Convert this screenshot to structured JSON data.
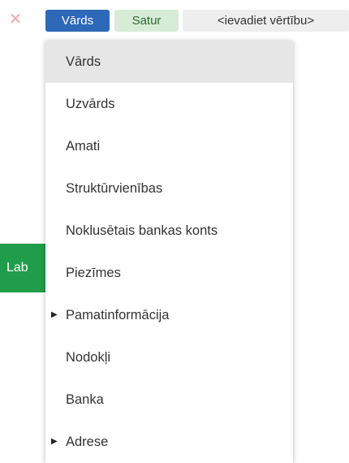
{
  "filter": {
    "remove_symbol": "✕",
    "field_chip": "Vārds",
    "operator_chip": "Satur",
    "value_chip": "<ievadiet vērtību>"
  },
  "side_button": {
    "label": "Lab"
  },
  "dropdown": {
    "items": [
      {
        "label": "Vārds",
        "selected": true
      },
      {
        "label": "Uzvārds"
      },
      {
        "label": "Amati"
      },
      {
        "label": "Struktūrvienības"
      },
      {
        "label": "Noklusētais bankas konts"
      },
      {
        "label": "Piezīmes"
      },
      {
        "label": "Pamatinformācija",
        "expandable": true
      },
      {
        "label": "Nodokļi"
      },
      {
        "label": "Banka"
      },
      {
        "label": "Adrese",
        "expandable": true
      }
    ]
  },
  "colors": {
    "field_chip_bg": "#2e68b8",
    "operator_chip_bg": "#d6ecd6",
    "value_chip_bg": "#eeeeee",
    "side_button_bg": "#1f9d4b",
    "selected_item_bg": "#e6e6e6"
  }
}
